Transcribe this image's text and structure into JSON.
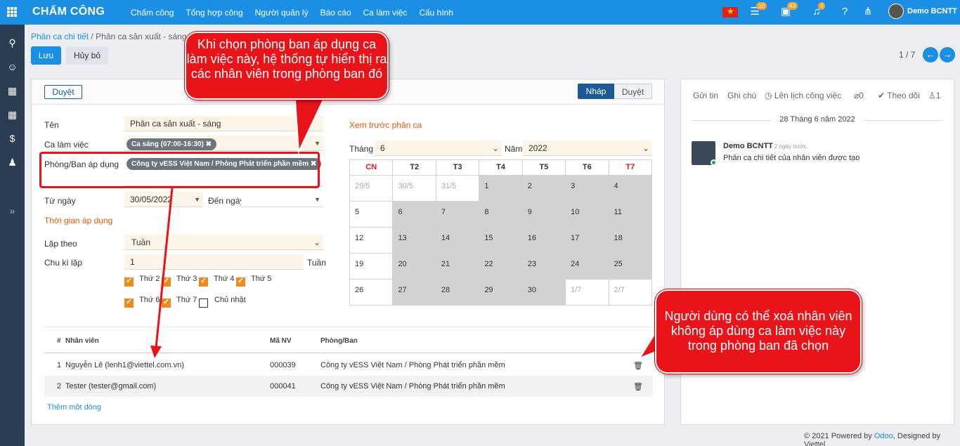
{
  "topbar": {
    "app_name": "CHẤM CÔNG",
    "menu": [
      "Chấm công",
      "Tổng hợp công",
      "Người quản lý",
      "Báo cáo",
      "Ca làm việc",
      "Cấu hình"
    ],
    "badges": {
      "activities": "10",
      "messages": "43",
      "notifications": "4"
    },
    "user": "Demo BCNTT"
  },
  "breadcrumb": {
    "parent": "Phân ca chi tiết",
    "separator": "/",
    "current": "Phân ca sản xuất - sáng"
  },
  "actions": {
    "save": "Lưu",
    "discard": "Hủy bỏ"
  },
  "pager": {
    "text": "1 / 7"
  },
  "status": {
    "approve_button": "Duyệt",
    "stages": [
      "Nháp",
      "Duyệt"
    ],
    "active_stage": "Nháp"
  },
  "form": {
    "name_label": "Tên",
    "name_value": "Phân ca sản xuất - sáng",
    "shift_label": "Ca làm việc",
    "shift_tag": "Ca sáng (07:00-16:30)",
    "dept_label": "Phòng/Ban áp dụng",
    "dept_tag": "Công ty vESS Việt Nam / Phòng Phát triển phần mềm",
    "from_label": "Từ ngày",
    "from_value": "30/05/2022",
    "to_label": "Đến ngày",
    "to_value": "",
    "apply_time_title": "Thời gian áp dụng",
    "repeat_label": "Lặp theo",
    "repeat_value": "Tuần",
    "cycle_label": "Chu kì lặp",
    "cycle_value": "1",
    "cycle_unit": "Tuần",
    "weekdays": [
      {
        "label": "Thứ 2",
        "checked": true
      },
      {
        "label": "Thứ 3",
        "checked": true
      },
      {
        "label": "Thứ 4",
        "checked": true
      },
      {
        "label": "Thứ 5",
        "checked": true
      },
      {
        "label": "Thứ 6",
        "checked": true
      },
      {
        "label": "Thứ 7",
        "checked": true
      },
      {
        "label": "Chủ nhật",
        "checked": false
      }
    ]
  },
  "preview": {
    "title": "Xem trước phân ca",
    "month_label": "Tháng",
    "month_value": "6",
    "year_label": "Năm",
    "year_value": "2022",
    "weekday_headers": [
      "CN",
      "T2",
      "T3",
      "T4",
      "T5",
      "T6",
      "T7"
    ],
    "weeks": [
      [
        {
          "d": "29/5",
          "s": "muted"
        },
        {
          "d": "30/5",
          "s": "muted"
        },
        {
          "d": "31/5",
          "s": "muted"
        },
        {
          "d": "1",
          "s": "grey"
        },
        {
          "d": "2",
          "s": "grey"
        },
        {
          "d": "3",
          "s": "grey"
        },
        {
          "d": "4",
          "s": "grey"
        }
      ],
      [
        {
          "d": "5",
          "s": ""
        },
        {
          "d": "6",
          "s": "grey"
        },
        {
          "d": "7",
          "s": "grey"
        },
        {
          "d": "8",
          "s": "grey"
        },
        {
          "d": "9",
          "s": "grey"
        },
        {
          "d": "10",
          "s": "grey"
        },
        {
          "d": "11",
          "s": "grey"
        }
      ],
      [
        {
          "d": "12",
          "s": ""
        },
        {
          "d": "13",
          "s": "grey"
        },
        {
          "d": "14",
          "s": "grey"
        },
        {
          "d": "15",
          "s": "grey"
        },
        {
          "d": "16",
          "s": "grey"
        },
        {
          "d": "17",
          "s": "grey"
        },
        {
          "d": "18",
          "s": "grey"
        }
      ],
      [
        {
          "d": "19",
          "s": ""
        },
        {
          "d": "20",
          "s": "grey"
        },
        {
          "d": "21",
          "s": "grey"
        },
        {
          "d": "22",
          "s": "grey"
        },
        {
          "d": "23",
          "s": "grey"
        },
        {
          "d": "24",
          "s": "grey"
        },
        {
          "d": "25",
          "s": "grey"
        }
      ],
      [
        {
          "d": "26",
          "s": ""
        },
        {
          "d": "27",
          "s": "grey"
        },
        {
          "d": "28",
          "s": "grey"
        },
        {
          "d": "29",
          "s": "grey"
        },
        {
          "d": "30",
          "s": "grey"
        },
        {
          "d": "1/7",
          "s": "muted"
        },
        {
          "d": "2/7",
          "s": "muted"
        }
      ]
    ]
  },
  "employees": {
    "headers": {
      "index": "#",
      "name": "Nhân viên",
      "code": "Mã NV",
      "dept": "Phòng/Ban"
    },
    "rows": [
      {
        "index": "1",
        "name": "Nguyễn Lê (lenh1@viettel.com.vn)",
        "code": "000039",
        "dept": "Công ty vESS Việt Nam / Phòng Phát triển phần mềm"
      },
      {
        "index": "2",
        "name": "Tester (tester@gmail.com)",
        "code": "000041",
        "dept": "Công ty vESS Việt Nam / Phòng Phát triển phần mềm"
      }
    ],
    "add_line": "Thêm một dòng"
  },
  "chatter": {
    "send_message": "Gửi tin",
    "log_note": "Ghi chú",
    "schedule_activity": "Lên lịch công việc",
    "attachments": "0",
    "follow": "Theo dõi",
    "followers": "1",
    "date": "28 Tháng 6 năm 2022",
    "author": "Demo BCNTT",
    "time": "- 2 ngày trước",
    "body": "Phân ca chi tiết của nhân viên được tạo"
  },
  "footer": {
    "prefix": "© 2021 Powered by ",
    "odoo": "Odoo",
    "suffix": ", Designed by Viettel"
  },
  "annotations": {
    "callout_department": "Khi chọn phòng ban áp dụng ca làm việc này, hệ thống tự hiển thị ra các nhân viên trong phòng ban đó",
    "callout_delete": "Người dùng có thể xoá nhân viên không áp dùng ca làm việc này trong phòng ban đã chọn"
  },
  "colors": {
    "primary": "#1b8fe4",
    "rail": "#2b3d50",
    "callout": "#e8141a",
    "stage_active": "#1b5a94",
    "weekend": "#e8141a"
  }
}
